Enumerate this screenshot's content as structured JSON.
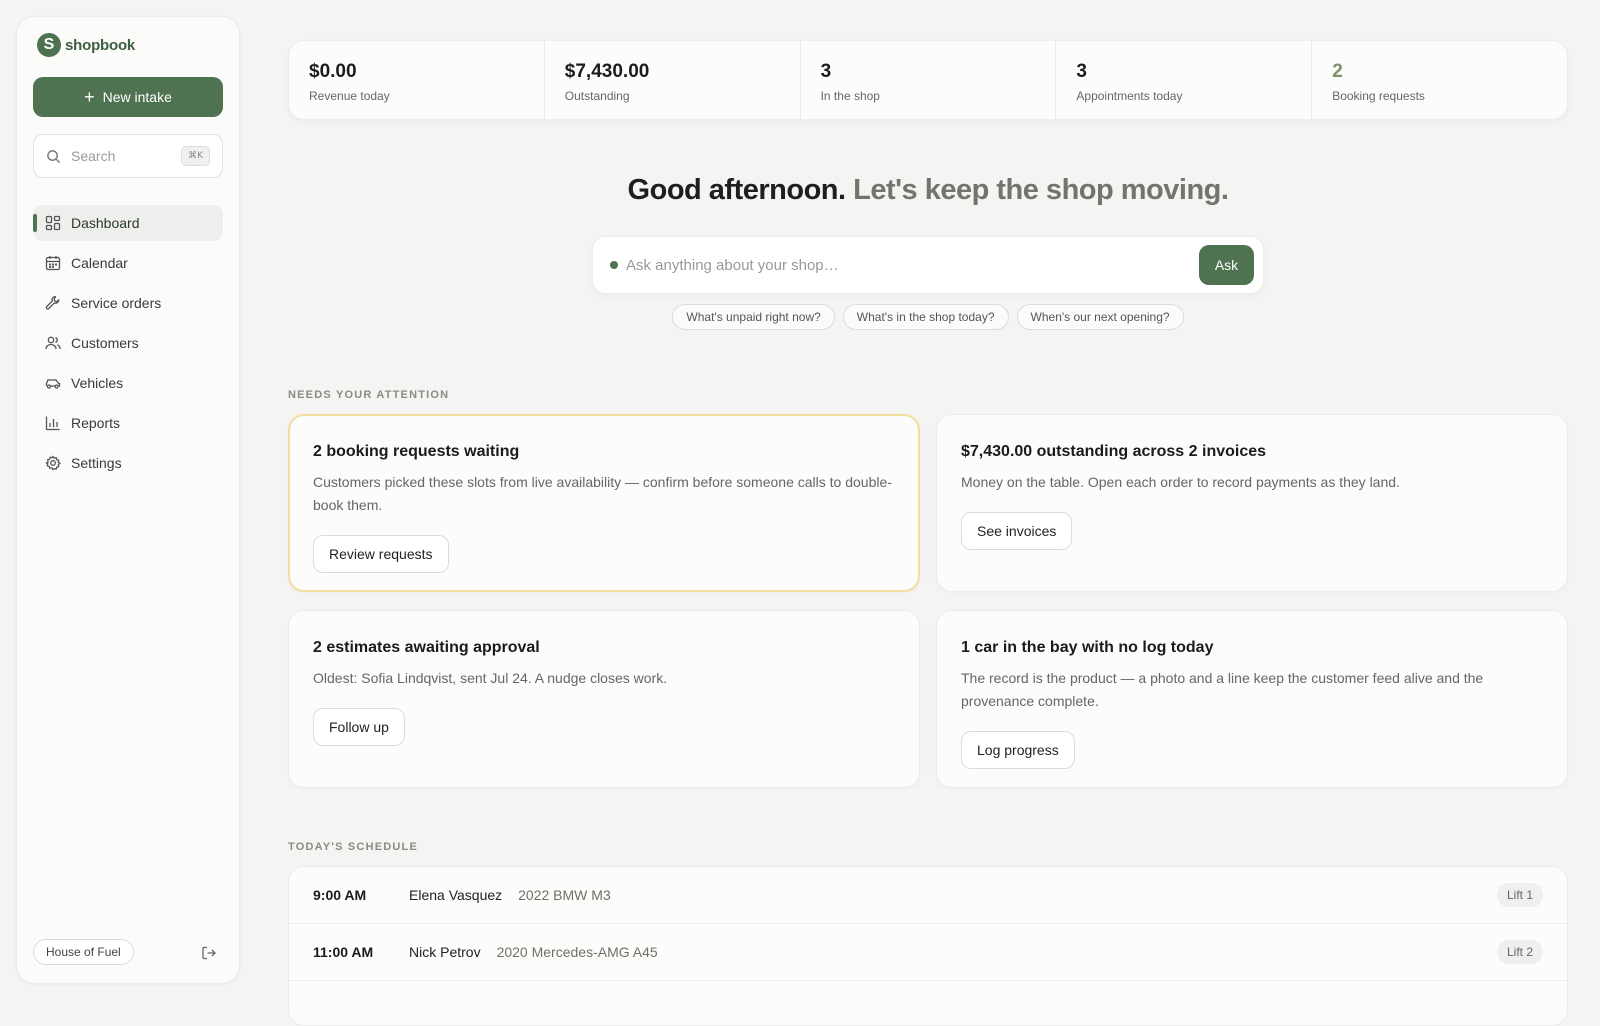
{
  "brand": {
    "logo_letter": "S",
    "name": "shopbook",
    "accent": "#4f7251"
  },
  "sidebar": {
    "new_intake_label": "New intake",
    "search_placeholder": "Search",
    "search_shortcut": "⌘K",
    "items": [
      {
        "label": "Dashboard",
        "icon": "dashboard-icon",
        "active": true
      },
      {
        "label": "Calendar",
        "icon": "calendar-icon"
      },
      {
        "label": "Service orders",
        "icon": "wrench-icon"
      },
      {
        "label": "Customers",
        "icon": "users-icon"
      },
      {
        "label": "Vehicles",
        "icon": "car-icon"
      },
      {
        "label": "Reports",
        "icon": "bar-chart-icon"
      },
      {
        "label": "Settings",
        "icon": "gear-icon"
      }
    ],
    "workspace": "House of Fuel",
    "logout_icon": "logout-icon"
  },
  "stats": [
    {
      "value": "$0.00",
      "label": "Revenue today"
    },
    {
      "value": "$7,430.00",
      "label": "Outstanding"
    },
    {
      "value": "3",
      "label": "In the shop"
    },
    {
      "value": "3",
      "label": "Appointments today"
    },
    {
      "value": "2",
      "label": "Booking requests"
    }
  ],
  "greeting": {
    "main": "Good afternoon.",
    "sub": "Let's keep the shop moving."
  },
  "ask": {
    "placeholder": "Ask anything about your shop…",
    "button": "Ask",
    "suggestions": [
      "What's unpaid right now?",
      "What's in the shop today?",
      "When's our next opening?"
    ]
  },
  "attention": {
    "label": "NEEDS YOUR ATTENTION",
    "cards": [
      {
        "title": "2 booking requests waiting",
        "desc": "Customers picked these slots from live availability — confirm before someone calls to double-book them.",
        "button": "Review requests",
        "highlight": true
      },
      {
        "title": "$7,430.00 outstanding across 2 invoices",
        "desc": "Money on the table. Open each order to record payments as they land.",
        "button": "See invoices"
      },
      {
        "title": "2 estimates awaiting approval",
        "desc": "Oldest: Sofia Lindqvist, sent Jul 24. A nudge closes work.",
        "button": "Follow up"
      },
      {
        "title": "1 car in the bay with no log today",
        "desc": "The record is the product — a photo and a line keep the customer feed alive and the provenance complete.",
        "button": "Log progress"
      }
    ]
  },
  "schedule": {
    "label": "TODAY'S SCHEDULE",
    "rows": [
      {
        "time": "9:00 AM",
        "name": "Elena Vasquez",
        "vehicle": "2022 BMW M3",
        "lift": "Lift 1"
      },
      {
        "time": "11:00 AM",
        "name": "Nick Petrov",
        "vehicle": "2020 Mercedes-AMG A45",
        "lift": "Lift 2"
      }
    ]
  },
  "colors": {
    "highlight_border": "#f1dfa0",
    "booking_accent": "#7d8f6c"
  }
}
